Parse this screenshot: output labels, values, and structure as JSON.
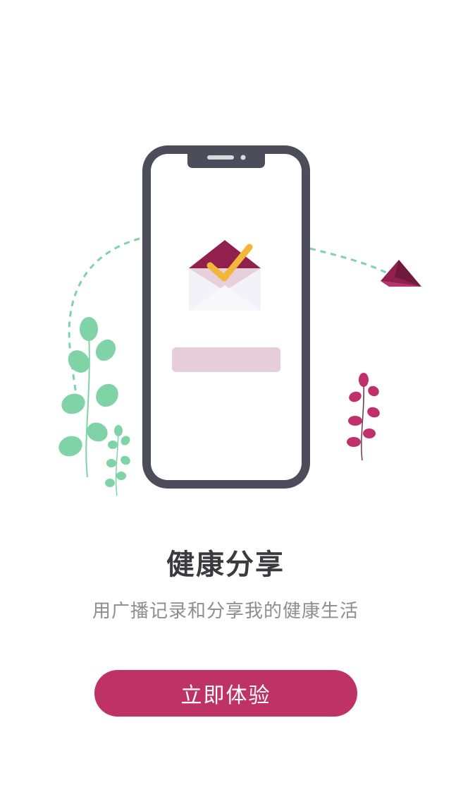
{
  "onboarding": {
    "title": "健康分享",
    "subtitle": "用广播记录和分享我的健康生活",
    "cta_label": "立即体验"
  },
  "colors": {
    "accent": "#bf3264",
    "phone_frame": "#4d4c5a",
    "leaf_green": "#7fd3a6",
    "leaf_magenta": "#c0306a",
    "envelope_dark": "#92204e",
    "check_yellow": "#f4b638",
    "placeholder_bar": "#e5cdd9"
  },
  "icons": [
    "phone-illustration",
    "envelope-check-icon",
    "paper-plane-icon",
    "green-plant",
    "magenta-plant"
  ]
}
